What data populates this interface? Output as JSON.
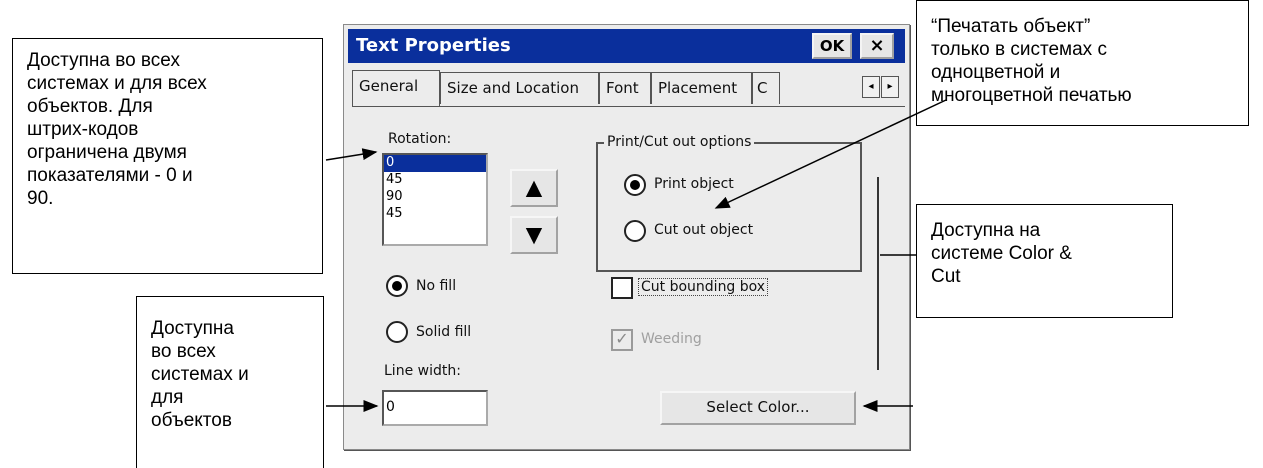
{
  "dialog": {
    "title": "Text Properties",
    "ok_label": "OK",
    "close_label": "×",
    "tabs": [
      {
        "label": "General",
        "active": true
      },
      {
        "label": "Size and Location",
        "active": false
      },
      {
        "label": "Font",
        "active": false
      },
      {
        "label": "Placement",
        "active": false
      },
      {
        "label": "C",
        "active": false
      }
    ],
    "tab_scroll_left": "◂",
    "tab_scroll_right": "▸",
    "rotation": {
      "label": "Rotation:",
      "options": [
        "0",
        "45",
        "90",
        "45"
      ],
      "selected": "0",
      "up_glyph": "▲",
      "down_glyph": "▼"
    },
    "print_cut": {
      "group_label": "Print/Cut out options",
      "print_object_label": "Print object",
      "cut_out_object_label": "Cut out object",
      "selected": "Print object"
    },
    "fill": {
      "no_fill_label": "No fill",
      "solid_fill_label": "Solid fill",
      "selected": "No fill"
    },
    "cut_bounding_box_label": "Cut bounding box",
    "weeding_label": "Weeding",
    "weeding_check_glyph": "✓",
    "line_width": {
      "label": "Line width:",
      "value": "0"
    },
    "select_color_label": "Select Color..."
  },
  "callouts": {
    "rotation_note": "Доступна во всех\nсистемах и для всех\nобъектов. Для\nштрих-кодов\nограничена двумя\nпоказателями - 0 и\n90.",
    "print_note": "“Печатать объект”\nтолько в системах с\nодноцветной и\nмногоцветной печатью",
    "color_cut_note": "Доступна на\nсистеме Color &\nCut",
    "line_width_note": "Доступна\nво всех\nсистемах и\nдля\nобъектов"
  },
  "colors": {
    "titlebar": "#0a2f9c",
    "dialog_bg": "#ececec",
    "selection": "#0a2f9c"
  }
}
